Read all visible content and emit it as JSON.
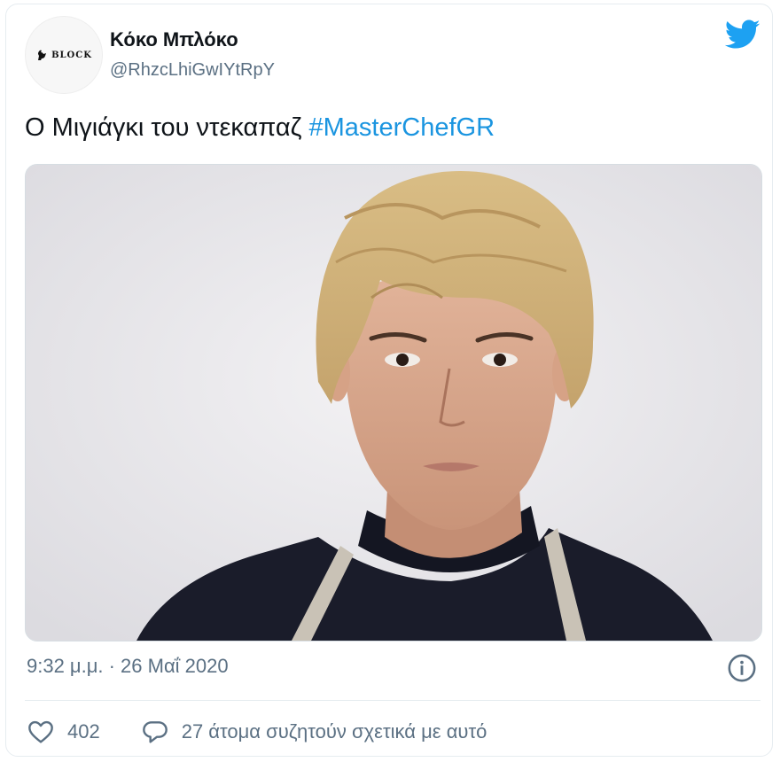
{
  "user": {
    "display_name": "Κόκο Μπλόκο",
    "handle": "@RhzcLhiGwIYtRpY",
    "avatar_text": "BLOCK"
  },
  "tweet": {
    "text": "Ο Μιγιάγκι του ντεκαπαζ ",
    "hashtag": "#MasterChefGR",
    "timestamp": "9:32 μ.μ. · 26 Μαΐ 2020"
  },
  "actions": {
    "likes": "402",
    "discussion": "27 άτομα συζητούν σχετικά με αυτό"
  },
  "colors": {
    "brand": "#1da1f2",
    "hashtag": "#1b95e0",
    "secondary_text": "#5b7083"
  },
  "icons": [
    "twitter-bird-icon",
    "info-icon",
    "heart-icon",
    "reply-icon"
  ]
}
